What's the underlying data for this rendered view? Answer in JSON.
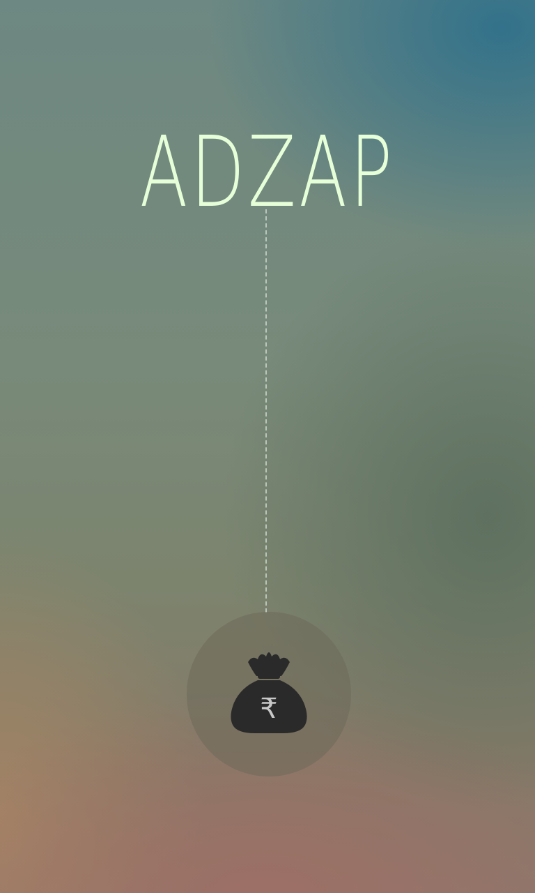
{
  "app": {
    "title": "ADZAP"
  },
  "pull_button": {
    "icon": "money-bag-rupee-icon",
    "currency_symbol": "₹"
  },
  "colors": {
    "title_text": "#e6ffd8",
    "bag_fill": "#2a2a2a",
    "bag_symbol": "#c8c8c8"
  }
}
